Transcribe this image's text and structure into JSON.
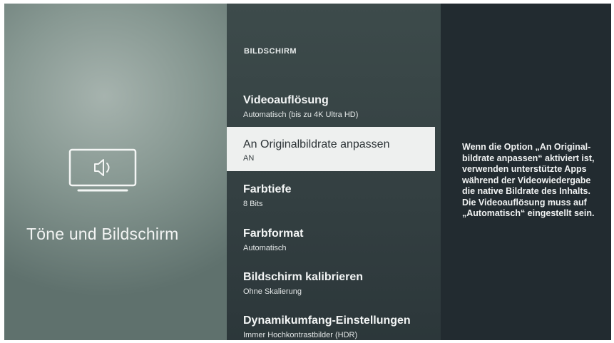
{
  "left": {
    "section_title": "Töne und Bildschirm",
    "icon": "tv-speaker-icon"
  },
  "menu": {
    "header": "BILDSCHIRM",
    "items": [
      {
        "title": "Videoauflösung",
        "value": "Automatisch (bis zu 4K Ultra HD)",
        "selected": false
      },
      {
        "title": "An Originalbildrate anpassen",
        "value": "AN",
        "selected": true
      },
      {
        "title": "Farbtiefe",
        "value": "8 Bits",
        "selected": false
      },
      {
        "title": "Farbformat",
        "value": "Automatisch",
        "selected": false
      },
      {
        "title": "Bildschirm kalibrieren",
        "value": "Ohne Skalierung",
        "selected": false
      },
      {
        "title": "Dynamikumfang-Einstellungen",
        "value": "Immer Hochkontrastbilder (HDR)",
        "selected": false
      }
    ]
  },
  "info": {
    "lines": [
      "Wenn die Option „An Original-",
      "bildrate anpassen“ aktiviert ist,",
      "verwenden unterstützte Apps",
      "während der Videowiedergabe",
      "die native Bildrate des Inhalts.",
      "Die Videoauflösung muss auf",
      "„Automatisch“ eingestellt sein."
    ]
  },
  "colors": {
    "selected_background": "#eef0ef",
    "menu_background": "#37444a",
    "info_background": "#222b30"
  }
}
